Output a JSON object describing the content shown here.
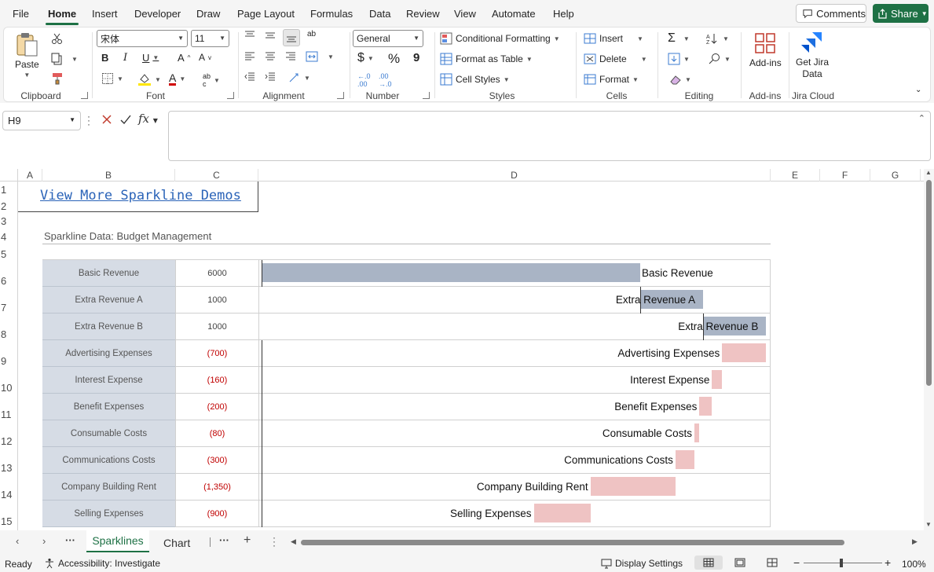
{
  "menu": {
    "items": [
      "File",
      "Home",
      "Insert",
      "Developer",
      "Draw",
      "Page Layout",
      "Formulas",
      "Data",
      "Review",
      "View",
      "Automate",
      "Help"
    ],
    "active": "Home",
    "comments_label": "Comments",
    "share_label": "Share"
  },
  "ribbon": {
    "clipboard": {
      "label": "Clipboard",
      "paste_label": "Paste"
    },
    "font": {
      "label": "Font",
      "font_name": "宋体",
      "font_size": "11"
    },
    "alignment": {
      "label": "Alignment"
    },
    "number": {
      "label": "Number",
      "format": "General",
      "currency": "$",
      "percent": "%",
      "comma": "9"
    },
    "styles": {
      "label": "Styles",
      "conditional_formatting": "Conditional Formatting",
      "format_as_table": "Format as Table",
      "cell_styles": "Cell Styles"
    },
    "cells": {
      "label": "Cells",
      "insert": "Insert",
      "delete": "Delete",
      "format": "Format"
    },
    "editing": {
      "label": "Editing"
    },
    "addins": {
      "label": "Add-ins",
      "button": "Add-ins"
    },
    "jira": {
      "label": "Jira Cloud",
      "button_line1": "Get Jira",
      "button_line2": "Data"
    }
  },
  "formula_bar": {
    "name_box": "H9",
    "fx": "fx",
    "formula": ""
  },
  "columns": [
    "A",
    "B",
    "C",
    "D",
    "E",
    "F",
    "G"
  ],
  "rows": [
    "1",
    "2",
    "3",
    "4",
    "5",
    "6",
    "7",
    "8",
    "9",
    "10",
    "11",
    "12",
    "13",
    "14",
    "15"
  ],
  "sheet": {
    "link_text": "View More Sparkline Demos",
    "section_title": "Sparkline Data: Budget Management",
    "items": [
      {
        "label": "Basic Revenue",
        "value": "6000",
        "amount": 6000
      },
      {
        "label": "Extra Revenue A",
        "value": "1000",
        "amount": 1000
      },
      {
        "label": "Extra Revenue B",
        "value": "1000",
        "amount": 1000
      },
      {
        "label": "Advertising Expenses",
        "value": "(700)",
        "amount": -700
      },
      {
        "label": "Interest Expense",
        "value": "(160)",
        "amount": -160
      },
      {
        "label": "Benefit Expenses",
        "value": "(200)",
        "amount": -200
      },
      {
        "label": "Consumable Costs",
        "value": "(80)",
        "amount": -80
      },
      {
        "label": "Communications Costs",
        "value": "(300)",
        "amount": -300
      },
      {
        "label": "Company Building Rent",
        "value": "(1,350)",
        "amount": -1350
      },
      {
        "label": "Selling Expenses",
        "value": "(900)",
        "amount": -900
      }
    ],
    "colors": {
      "positive": "#a9b4c5",
      "negative": "#efc3c3",
      "label_fill": "#d6dce5",
      "negative_text": "#c00000"
    }
  },
  "tabs": {
    "items": [
      "Sparklines",
      "Chart"
    ],
    "active": "Sparklines"
  },
  "status": {
    "ready": "Ready",
    "accessibility": "Accessibility: Investigate",
    "display_settings": "Display Settings",
    "zoom": "100%"
  }
}
